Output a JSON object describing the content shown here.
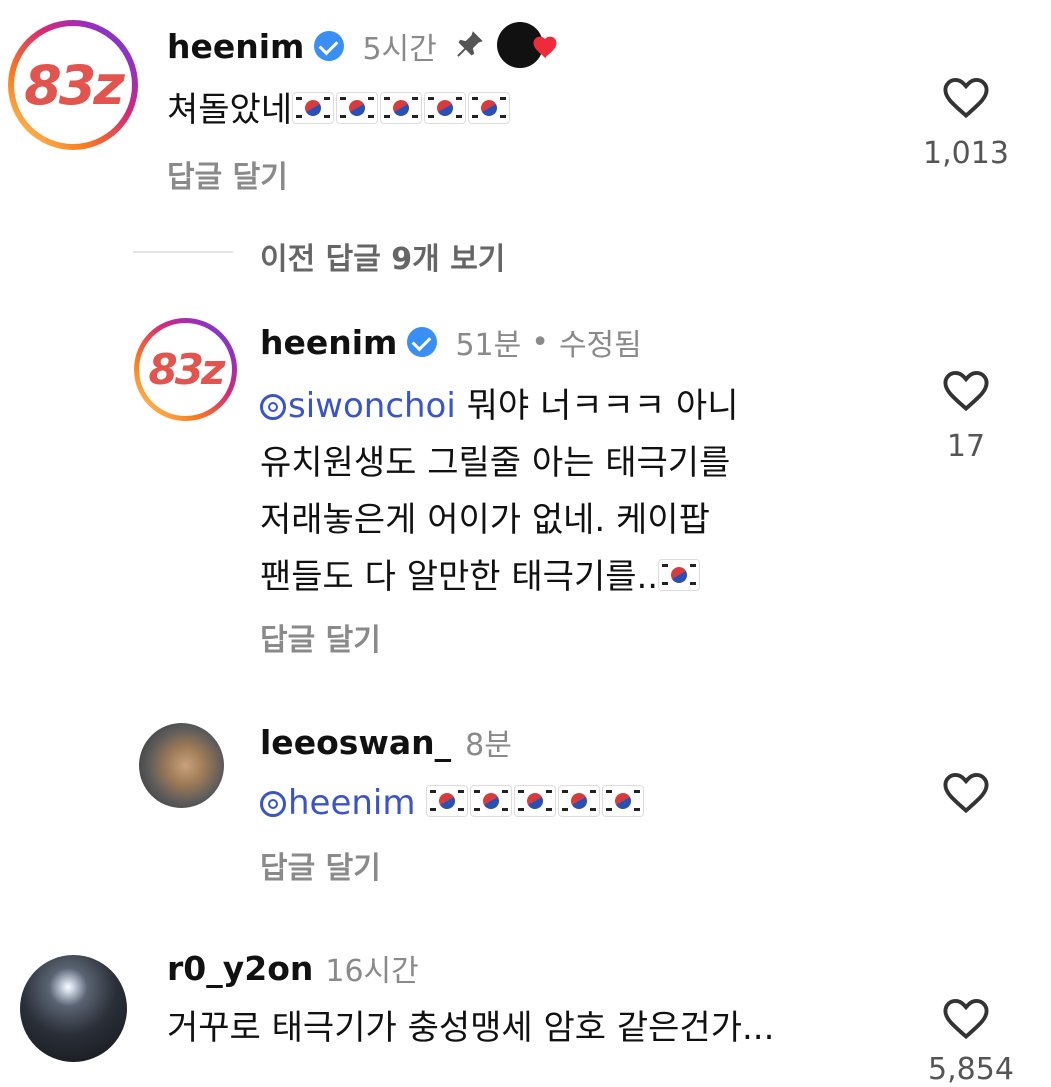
{
  "comments": [
    {
      "username": "heenim",
      "time": "5시간",
      "text": "쳐돌았네",
      "flag_count": 5,
      "reply_label": "답글 달기",
      "likes": "1,013",
      "avatar_text": "83z"
    }
  ],
  "view_replies": "이전 답글 9개 보기",
  "replies": [
    {
      "username": "heenim",
      "time": "51분",
      "separator": "•",
      "edited": "수정됨",
      "mention": "siwonchoi",
      "lines": [
        "뭐야 너ㅋㅋㅋ 아니",
        "유치원생도 그릴줄 아는 태극기를",
        "저래놓은게 어이가 없네. 케이팝",
        "팬들도 다 알만한 태극기를.."
      ],
      "reply_label": "답글 달기",
      "likes": "17",
      "avatar_text": "83z"
    },
    {
      "username": "leeoswan_",
      "time": "8분",
      "mention": "heenim",
      "reply_label": "답글 달기"
    }
  ],
  "comment2": {
    "username": "r0_y2on",
    "time": "16시간",
    "text": "거꾸로 태극기가 충성맹세 암호 같은건가...",
    "likes": "5,854"
  },
  "colors": {
    "accent": "#3b55c9",
    "verified": "#3a8ff5",
    "heart_red": "#ee2b3b",
    "muted": "#8a8a8a"
  }
}
